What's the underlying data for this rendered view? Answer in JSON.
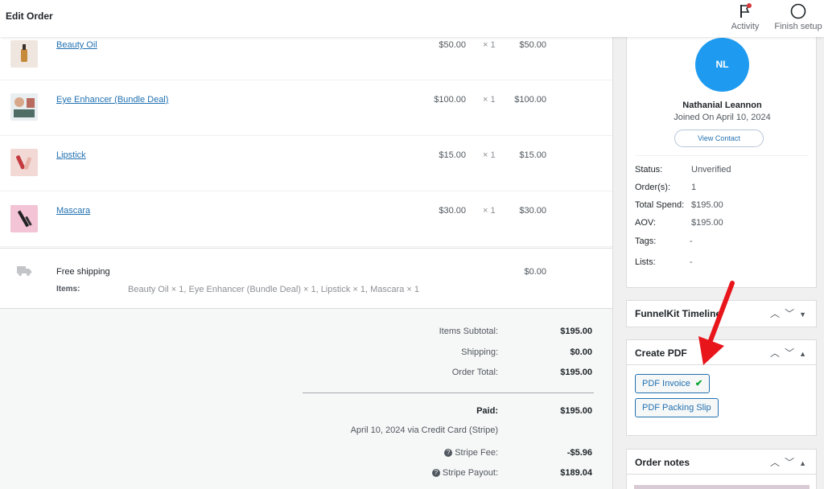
{
  "header": {
    "title": "Edit Order",
    "activity_label": "Activity",
    "finish_label": "Finish setup"
  },
  "items": [
    {
      "name": "Beauty Oil",
      "cost": "$50.00",
      "qty": "× 1",
      "total": "$50.00",
      "thumb_icon": "beauty-oil-thumbnail"
    },
    {
      "name": "Eye Enhancer (Bundle Deal)",
      "cost": "$100.00",
      "qty": "× 1",
      "total": "$100.00",
      "thumb_icon": "eye-enhancer-thumbnail"
    },
    {
      "name": "Lipstick",
      "cost": "$15.00",
      "qty": "× 1",
      "total": "$15.00",
      "thumb_icon": "lipstick-thumbnail"
    },
    {
      "name": "Mascara",
      "cost": "$30.00",
      "qty": "× 1",
      "total": "$30.00",
      "thumb_icon": "mascara-thumbnail"
    }
  ],
  "shipping": {
    "method": "Free shipping",
    "items_label": "Items:",
    "items_value": "Beauty Oil × 1, Eye Enhancer (Bundle Deal) × 1, Lipstick × 1, Mascara × 1",
    "cost": "$0.00"
  },
  "totals": {
    "subtotal_label": "Items Subtotal:",
    "subtotal": "$195.00",
    "shipping_label": "Shipping:",
    "shipping": "$0.00",
    "order_total_label": "Order Total:",
    "order_total": "$195.00",
    "paid_label": "Paid:",
    "paid": "$195.00",
    "paid_note": "April 10, 2024 via Credit Card (Stripe)",
    "stripe_fee_label": "Stripe Fee:",
    "stripe_fee": "-$5.96",
    "stripe_payout_label": "Stripe Payout:",
    "stripe_payout": "$189.04"
  },
  "customer": {
    "initials": "NL",
    "name": "Nathanial Leannon",
    "joined": "Joined On April 10, 2024",
    "view_contact": "View Contact",
    "status_label": "Status:",
    "status": "Unverified",
    "orders_label": "Order(s):",
    "orders": "1",
    "spend_label": "Total Spend:",
    "spend": "$195.00",
    "aov_label": "AOV:",
    "aov": "$195.00",
    "tags_label": "Tags:",
    "tags": "-",
    "lists_label": "Lists:",
    "lists": "-"
  },
  "funnelkit": {
    "title": "FunnelKit Timeline"
  },
  "pdf": {
    "title": "Create PDF",
    "invoice_label": "PDF Invoice",
    "packing_label": "PDF Packing Slip"
  },
  "notes": {
    "title": "Order notes"
  },
  "colors": {
    "accent": "#2271b1",
    "avatar": "#1e9bf0",
    "arrow": "#e8151b",
    "check": "#00a32a"
  }
}
